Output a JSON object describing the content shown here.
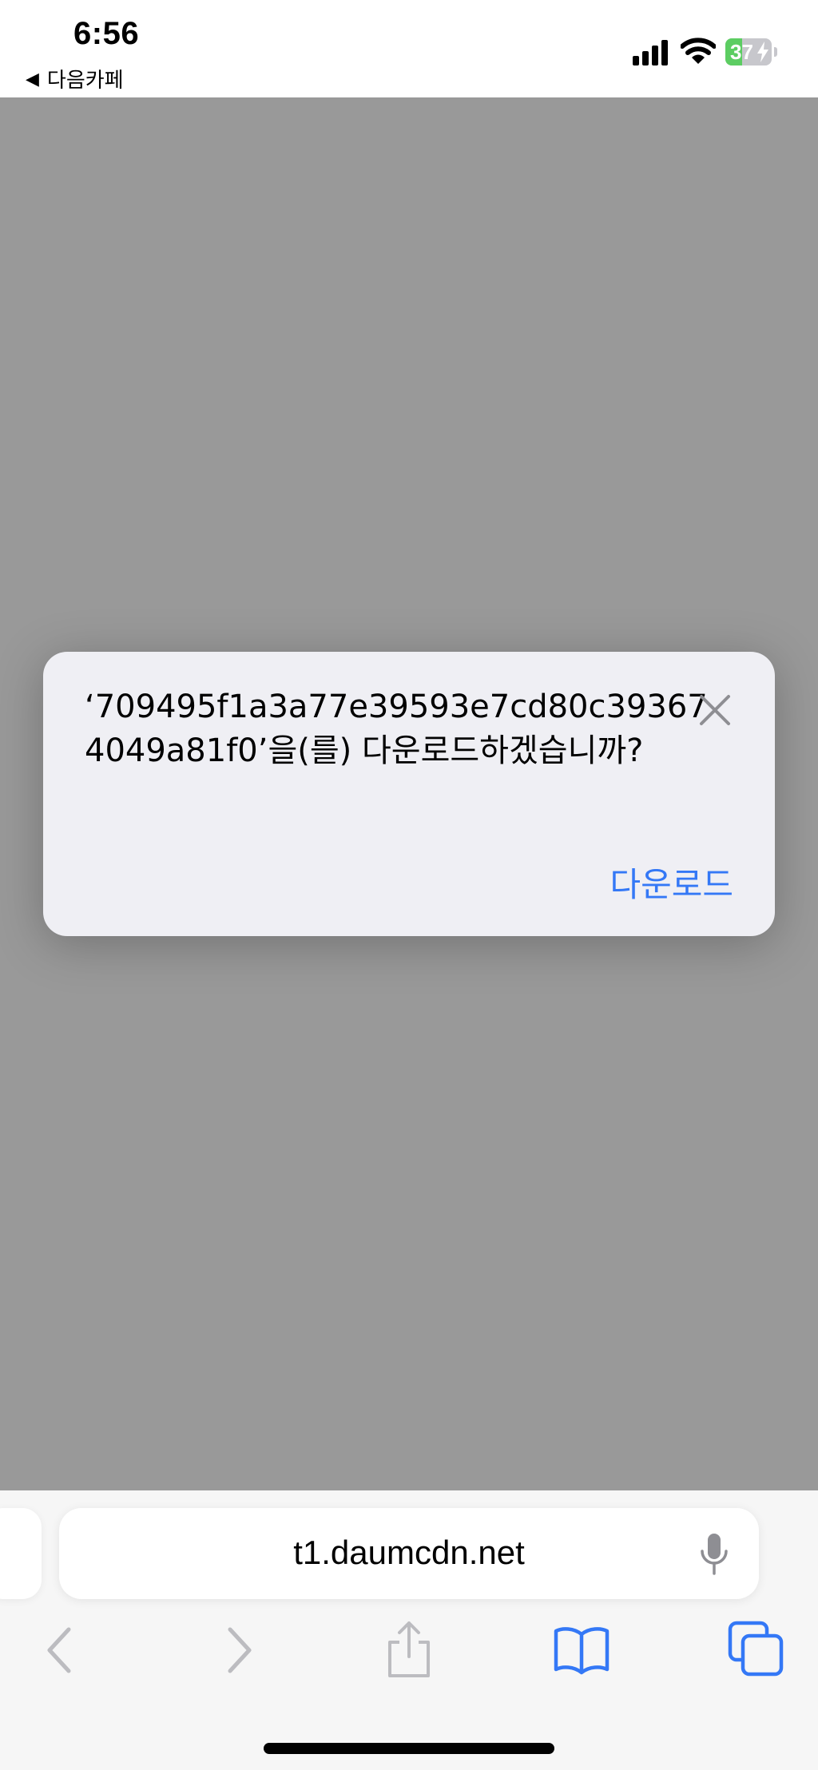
{
  "status_bar": {
    "time": "6:56",
    "back_label": "다음카페",
    "battery_percent": "37",
    "battery_level": 0.37,
    "battery_color": "#5ccd62",
    "icons": [
      "cellular-signal-icon",
      "wifi-icon",
      "battery-charging-icon"
    ]
  },
  "dialog": {
    "message": "‘709495f1a3a77e39593e7cd80c393674049a81f0’을(를) 다운로드하겠습니까?",
    "download_label": "다운로드",
    "accent_color": "#3478f6"
  },
  "browser": {
    "address": "t1.daumcdn.net",
    "toolbar_icons": [
      "back-icon",
      "forward-icon",
      "share-icon",
      "bookmarks-icon",
      "tabs-icon"
    ],
    "tint_color": "#3478f6"
  }
}
